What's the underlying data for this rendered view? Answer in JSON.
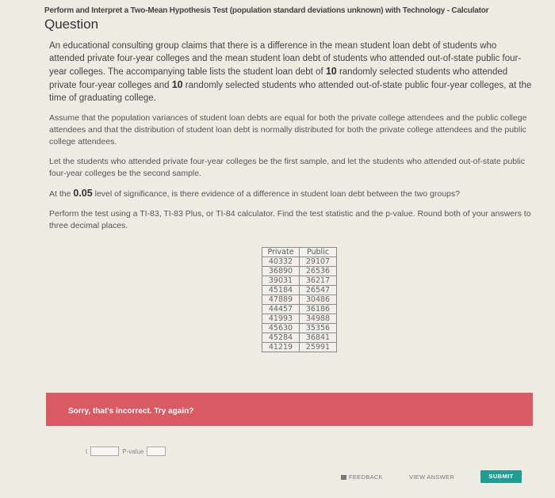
{
  "breadcrumb": "Perform and Interpret a Two-Mean Hypothesis Test (population standard deviations unknown) with Technology - Calculator",
  "title": "Question",
  "paragraphs": {
    "p1a": "An educational consulting group claims that there is a difference in the mean student loan debt of students who attended private four-year colleges and the mean student loan debt of students who attended out-of-state public four-year colleges. The accompanying table lists the student loan debt of ",
    "p1n1": "10",
    "p1b": " randomly selected students who attended private four-year colleges and ",
    "p1n2": "10",
    "p1c": " randomly selected students who attended out-of-state public four-year colleges, at the time of graduating college.",
    "p2": "Assume that the population variances of student loan debts are equal for both the private college attendees and the public college attendees and that the distribution of student loan debt is normally distributed for both the private college attendees and the public college attendees.",
    "p3": "Let the students who attended private four-year colleges be the first sample, and let the students who attended out-of-state public four-year colleges be the second sample.",
    "p4a": "At the ",
    "p4n": "0.05",
    "p4b": " level of significance, is there evidence of a difference in student loan debt between the two groups?",
    "p5": "Perform the test using a TI-83, TI-83 Plus, or TI-84 calculator. Find the test statistic and the p-value. Round both of your answers to three decimal places."
  },
  "table": {
    "headers": [
      "Private",
      "Public"
    ],
    "rows": [
      [
        "40332",
        "29107"
      ],
      [
        "36890",
        "26536"
      ],
      [
        "39031",
        "36217"
      ],
      [
        "45184",
        "26547"
      ],
      [
        "47889",
        "30486"
      ],
      [
        "44457",
        "36186"
      ],
      [
        "41993",
        "34988"
      ],
      [
        "45630",
        "35356"
      ],
      [
        "45284",
        "36841"
      ],
      [
        "41219",
        "25991"
      ]
    ]
  },
  "feedback": {
    "text": "Sorry, that's incorrect. Try again?",
    "color": "#d95a62"
  },
  "answer": {
    "t_label": "t",
    "t_value": "",
    "pvalue_label": "P-value",
    "p_value": ""
  },
  "actions": {
    "feedback_label": "FEEDBACK",
    "view_answer_label": "VIEW ANSWER",
    "submit_label": "SUBMIT",
    "submit_color": "#1f9d95"
  }
}
